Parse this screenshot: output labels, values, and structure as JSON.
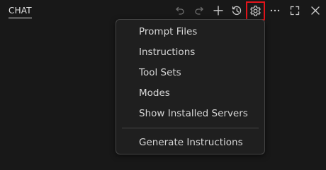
{
  "panel": {
    "tab_label": "CHAT"
  },
  "toolbar": {
    "buttons": [
      {
        "icon": "undo-icon",
        "enabled": false
      },
      {
        "icon": "redo-icon",
        "enabled": false
      },
      {
        "icon": "plus-icon",
        "enabled": true
      },
      {
        "icon": "history-icon",
        "enabled": true
      },
      {
        "icon": "gear-icon",
        "enabled": true,
        "highlighted": true
      },
      {
        "icon": "more-icon",
        "enabled": true
      },
      {
        "icon": "maximize-icon",
        "enabled": true
      },
      {
        "icon": "close-icon",
        "enabled": true
      }
    ],
    "highlight_color": "#e3141b"
  },
  "menu": {
    "items": [
      {
        "label": "Prompt Files"
      },
      {
        "label": "Instructions"
      },
      {
        "label": "Tool Sets"
      },
      {
        "label": "Modes"
      },
      {
        "label": "Show Installed Servers"
      }
    ],
    "footer_items": [
      {
        "label": "Generate Instructions"
      }
    ]
  },
  "colors": {
    "background": "#181818",
    "menu_background": "#1f1f1f",
    "text": "#d7d7d7",
    "icon": "#cccccc",
    "icon_disabled": "#6e6e6e"
  }
}
